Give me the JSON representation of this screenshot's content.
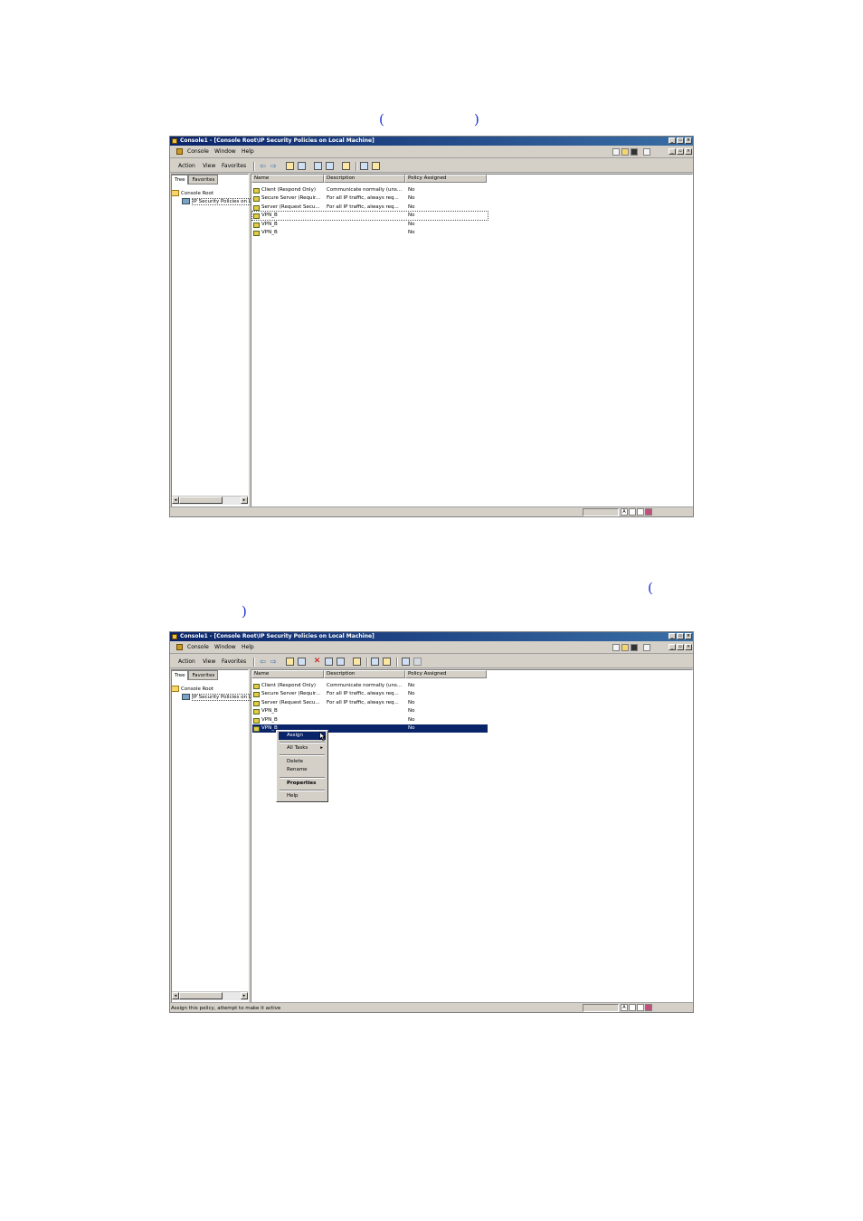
{
  "annotations": {
    "p1_open": "(",
    "p1_close": ")",
    "p2_open": "(",
    "p2_close": ")"
  },
  "window": {
    "title": "Console1 - [Console Root\\IP Security Policies on Local Machine]",
    "menu": [
      "Console",
      "Window",
      "Help"
    ],
    "action_menu": [
      "Action",
      "View",
      "Favorites"
    ],
    "tabs": [
      "Tree",
      "Favorites"
    ],
    "tree": [
      "Console Root",
      "IP Security Policies on L"
    ],
    "columns": [
      "Name",
      "Description",
      "Policy Assigned"
    ],
    "rows": [
      {
        "name": "Client (Respond Only)",
        "desc": "Communicate normally (uns...",
        "assigned": "No"
      },
      {
        "name": "Secure Server (Requir...",
        "desc": "For all IP traffic, always req...",
        "assigned": "No"
      },
      {
        "name": "Server (Request Secu...",
        "desc": "For all IP traffic, always req...",
        "assigned": "No"
      },
      {
        "name": "VPN_B",
        "desc": "",
        "assigned": "No"
      },
      {
        "name": "VPN_B",
        "desc": "",
        "assigned": "No"
      },
      {
        "name": "VPN_B",
        "desc": "",
        "assigned": "No"
      }
    ],
    "window_buttons": [
      "_",
      "▫",
      "×"
    ],
    "scroll_left": "◂",
    "scroll_right": "▸"
  },
  "context_menu": {
    "assign": "Assign",
    "all_tasks": "All Tasks",
    "all_tasks_arrow": "▸",
    "delete": "Delete",
    "rename": "Rename",
    "properties": "Properties",
    "help": "Help"
  },
  "status2": "Assign this policy, attempt to make it active"
}
